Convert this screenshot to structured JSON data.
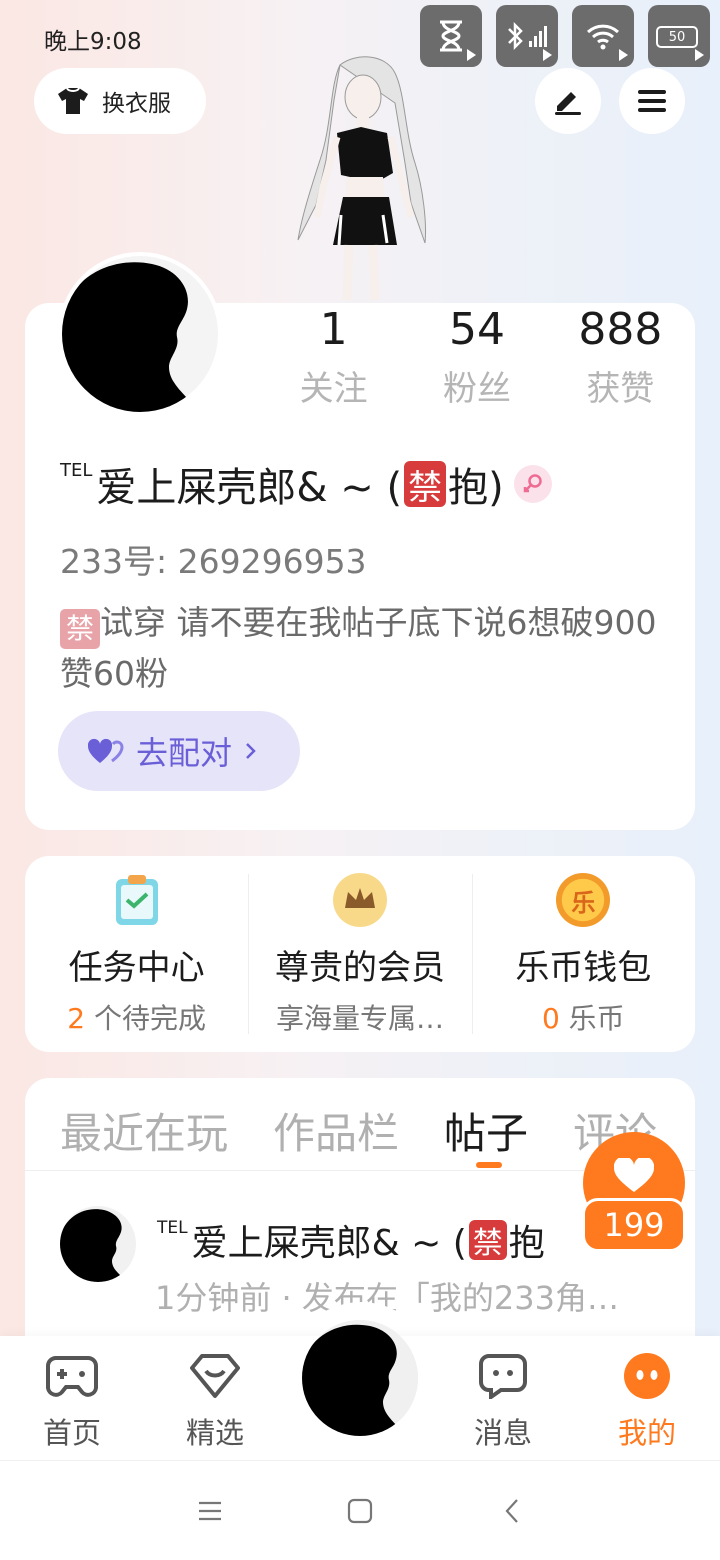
{
  "status_bar": {
    "time": "晚上9:08",
    "battery": "50"
  },
  "header": {
    "dress_label": "换衣服"
  },
  "profile": {
    "stats": [
      {
        "value": "1",
        "label": "关注"
      },
      {
        "value": "54",
        "label": "粉丝"
      },
      {
        "value": "888",
        "label": "获赞"
      }
    ],
    "tel_mark": "TEL",
    "name_part1": "爱上屎壳郎& ~ (",
    "ban_char": "禁",
    "name_part2": "抱)",
    "uid": "233号: 269296953",
    "bio_rest": "试穿      请不要在我帖子底下说6想破900赞60粉",
    "match_label": "去配对"
  },
  "services": [
    {
      "title": "任务中心",
      "sub_highlight": "2",
      "sub_text": " 个待完成"
    },
    {
      "title": "尊贵的会员",
      "sub_highlight": "",
      "sub_text": "享海量专属…"
    },
    {
      "title": "乐币钱包",
      "sub_highlight": "0",
      "sub_text": " 乐币",
      "icon_char": "乐"
    }
  ],
  "tabs": [
    "最近在玩",
    "作品栏",
    "帖子",
    "评论"
  ],
  "post": {
    "tel_mark": "TEL",
    "name_part1": "爱上屎壳郎& ~ (",
    "ban_char": "禁",
    "name_part2": "抱",
    "meta": "1分钟前 · 发布在「我的233角…"
  },
  "like_count": "199",
  "nav": [
    {
      "label": "首页"
    },
    {
      "label": "精选"
    },
    {
      "label": "消息"
    },
    {
      "label": "我的"
    }
  ],
  "colors": {
    "accent": "#ff7a1e",
    "match": "#6b5fd8",
    "ban": "#d83b3b"
  }
}
